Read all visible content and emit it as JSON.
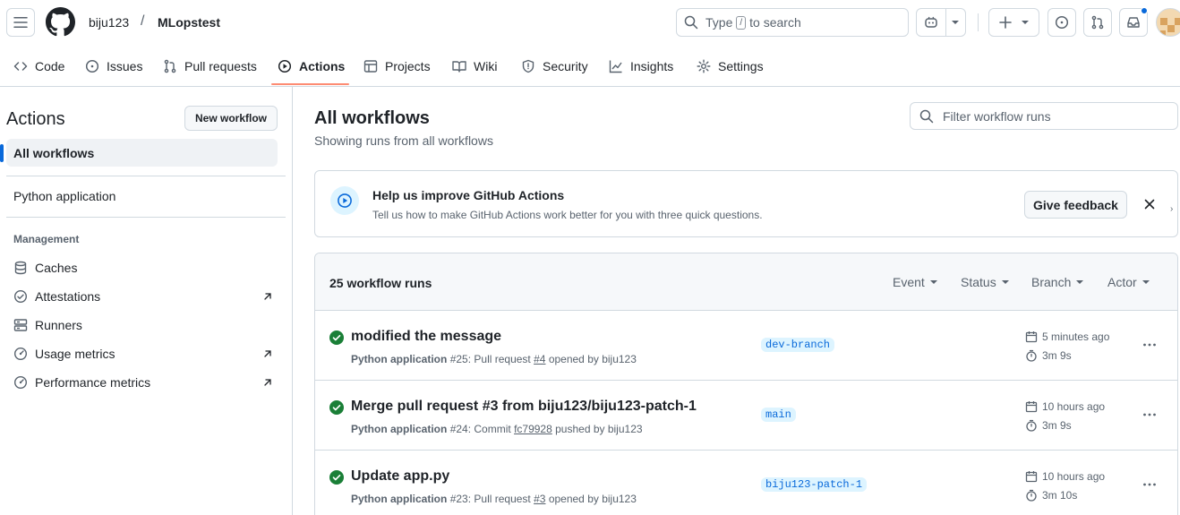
{
  "header": {
    "owner": "biju123",
    "separator": "/",
    "repo": "MLopstest",
    "search_prefix": "Type",
    "search_key": "/",
    "search_suffix": "to search"
  },
  "nav": {
    "tabs": [
      {
        "label": "Code",
        "icon": "code-icon"
      },
      {
        "label": "Issues",
        "icon": "issue-icon"
      },
      {
        "label": "Pull requests",
        "icon": "pull-request-icon"
      },
      {
        "label": "Actions",
        "icon": "play-icon",
        "active": true
      },
      {
        "label": "Projects",
        "icon": "table-icon"
      },
      {
        "label": "Wiki",
        "icon": "book-icon"
      },
      {
        "label": "Security",
        "icon": "shield-icon"
      },
      {
        "label": "Insights",
        "icon": "graph-icon"
      },
      {
        "label": "Settings",
        "icon": "gear-icon"
      }
    ]
  },
  "sidebar": {
    "title": "Actions",
    "new_workflow": "New workflow",
    "all_workflows": "All workflows",
    "workflow": "Python application",
    "management_heading": "Management",
    "links": [
      {
        "label": "Caches",
        "icon": "database-icon",
        "external": false
      },
      {
        "label": "Attestations",
        "icon": "verified-icon",
        "external": true
      },
      {
        "label": "Runners",
        "icon": "server-icon",
        "external": false
      },
      {
        "label": "Usage metrics",
        "icon": "meter-icon",
        "external": true
      },
      {
        "label": "Performance metrics",
        "icon": "meter-icon",
        "external": true
      }
    ]
  },
  "main": {
    "title": "All workflows",
    "subtitle": "Showing runs from all workflows",
    "filter_placeholder": "Filter workflow runs"
  },
  "banner": {
    "title": "Help us improve GitHub Actions",
    "description": "Tell us how to make GitHub Actions work better for you with three quick questions.",
    "button": "Give feedback"
  },
  "runs": {
    "count": "25 workflow runs",
    "filters": [
      "Event",
      "Status",
      "Branch",
      "Actor"
    ],
    "items": [
      {
        "title": "modified the message",
        "workflow": "Python application",
        "number": "#25",
        "event": "Pull request",
        "ref": "#4",
        "action": "opened by biju123",
        "branch": "dev-branch",
        "time": "5 minutes ago",
        "duration": "3m 9s",
        "status": "success"
      },
      {
        "title": "Merge pull request #3 from biju123/biju123-patch-1",
        "workflow": "Python application",
        "number": "#24",
        "event": "Commit",
        "ref": "fc79928",
        "action": "pushed by biju123",
        "branch": "main",
        "time": "10 hours ago",
        "duration": "3m 9s",
        "status": "success"
      },
      {
        "title": "Update app.py",
        "workflow": "Python application",
        "number": "#23",
        "event": "Pull request",
        "ref": "#3",
        "action": "opened by biju123",
        "branch": "biju123-patch-1",
        "time": "10 hours ago",
        "duration": "3m 10s",
        "status": "success"
      }
    ]
  },
  "colors": {
    "accent": "#0969da",
    "success": "#1a7f37",
    "tab_underline": "#fd8c73"
  }
}
